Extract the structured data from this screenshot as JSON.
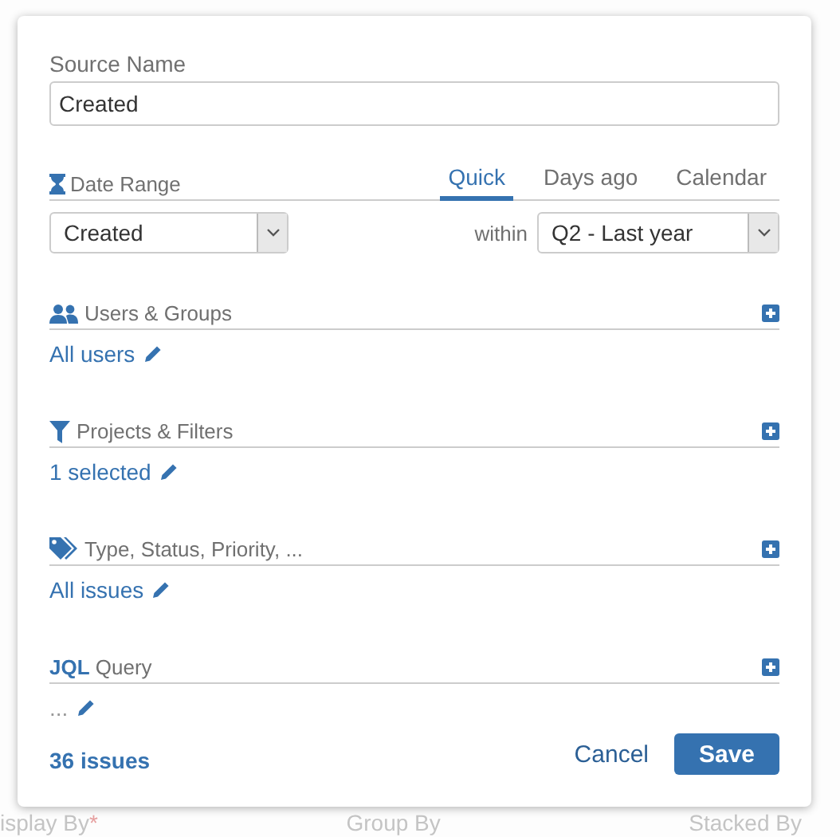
{
  "background": {
    "labels": [
      {
        "text": "isplay By",
        "required_mark": "*"
      },
      {
        "text": "Group By"
      },
      {
        "text": "Stacked By"
      }
    ]
  },
  "dialog": {
    "source_name": {
      "label": "Source Name",
      "value": "Created"
    },
    "date_range": {
      "title": "Date Range",
      "tabs": [
        {
          "label": "Quick",
          "selected": true
        },
        {
          "label": "Days ago",
          "selected": false
        },
        {
          "label": "Calendar",
          "selected": false
        }
      ],
      "field": "Created",
      "within_label": "within",
      "period": "Q2 - Last year"
    },
    "sections": [
      {
        "kind": "users",
        "title": "Users & Groups",
        "value": "All users"
      },
      {
        "kind": "filter",
        "title": "Projects & Filters",
        "value": "1 selected"
      },
      {
        "kind": "tag",
        "title": "Type, Status, Priority, ...",
        "value": "All issues"
      },
      {
        "kind": "jql",
        "title": "**JQL** Query",
        "value": "..."
      }
    ],
    "footer": {
      "count": "36 issues",
      "cancel": "Cancel",
      "save": "Save"
    }
  }
}
